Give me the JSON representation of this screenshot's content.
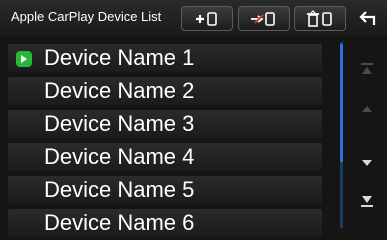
{
  "header": {
    "title": "Apple CarPlay Device List",
    "buttons": [
      {
        "name": "add-device",
        "icon": "add-device-icon"
      },
      {
        "name": "switch-device",
        "icon": "switch-device-icon"
      },
      {
        "name": "delete-device",
        "icon": "delete-device-icon"
      }
    ],
    "back_icon": "back-arrow-icon"
  },
  "devices": [
    {
      "label": "Device Name 1",
      "connected": true
    },
    {
      "label": "Device Name 2",
      "connected": false
    },
    {
      "label": "Device Name 3",
      "connected": false
    },
    {
      "label": "Device Name 4",
      "connected": false
    },
    {
      "label": "Device Name 5",
      "connected": false
    },
    {
      "label": "Device Name 6",
      "connected": false
    }
  ],
  "scroll_controls": [
    "scroll-top-icon",
    "scroll-up-icon",
    "scroll-down-icon",
    "scroll-bottom-icon"
  ],
  "colors": {
    "accent": "#2f6fd6",
    "carplay_green": "#27b83b",
    "background": "#151515"
  }
}
